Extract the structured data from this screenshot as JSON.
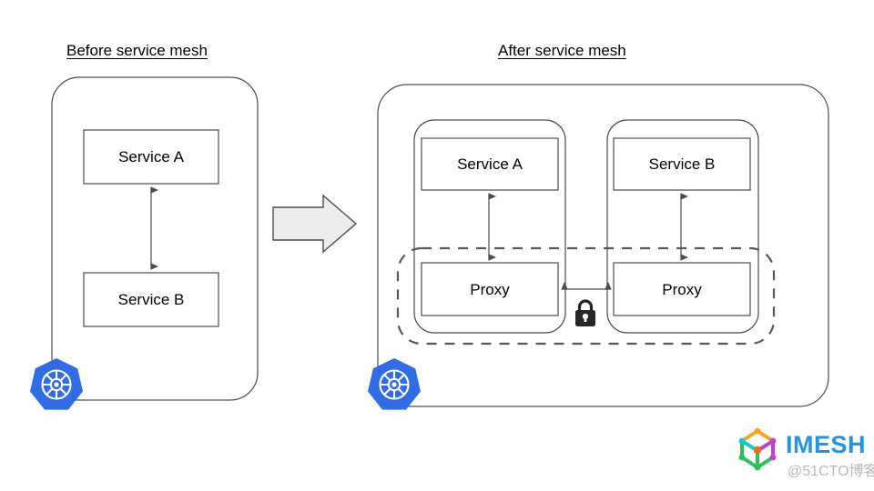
{
  "panels": {
    "before": {
      "title": "Before service mesh",
      "cluster_icon": "kubernetes-icon",
      "nodes": [
        {
          "label": "Service A"
        },
        {
          "label": "Service B"
        }
      ],
      "connector": "bidirectional-arrow"
    },
    "after": {
      "title": "After service mesh",
      "cluster_icon": "kubernetes-icon",
      "pods": [
        {
          "service_label": "Service A",
          "proxy_label": "Proxy"
        },
        {
          "service_label": "Service B",
          "proxy_label": "Proxy"
        }
      ],
      "mesh_boundary": "dashed-rounded-rect",
      "secure_icon": "lock-icon",
      "connector": "bidirectional-arrow"
    }
  },
  "transition": {
    "icon": "right-block-arrow"
  },
  "branding": {
    "logo_icon": "imesh-cube-icon",
    "name": "IMESH",
    "watermark": "@51CTO博客"
  },
  "colors": {
    "stroke": "#4d4d4d",
    "text": "#000000",
    "kubernetes_blue": "#326CE5",
    "arrow_fill": "#ececec",
    "arrow_stroke": "#4d4d4d",
    "dashed_stroke": "#595959",
    "lock": "#262626",
    "imesh_blue": "#2196E3",
    "watermark": "#b9b9b9",
    "background": "#ffffff"
  }
}
